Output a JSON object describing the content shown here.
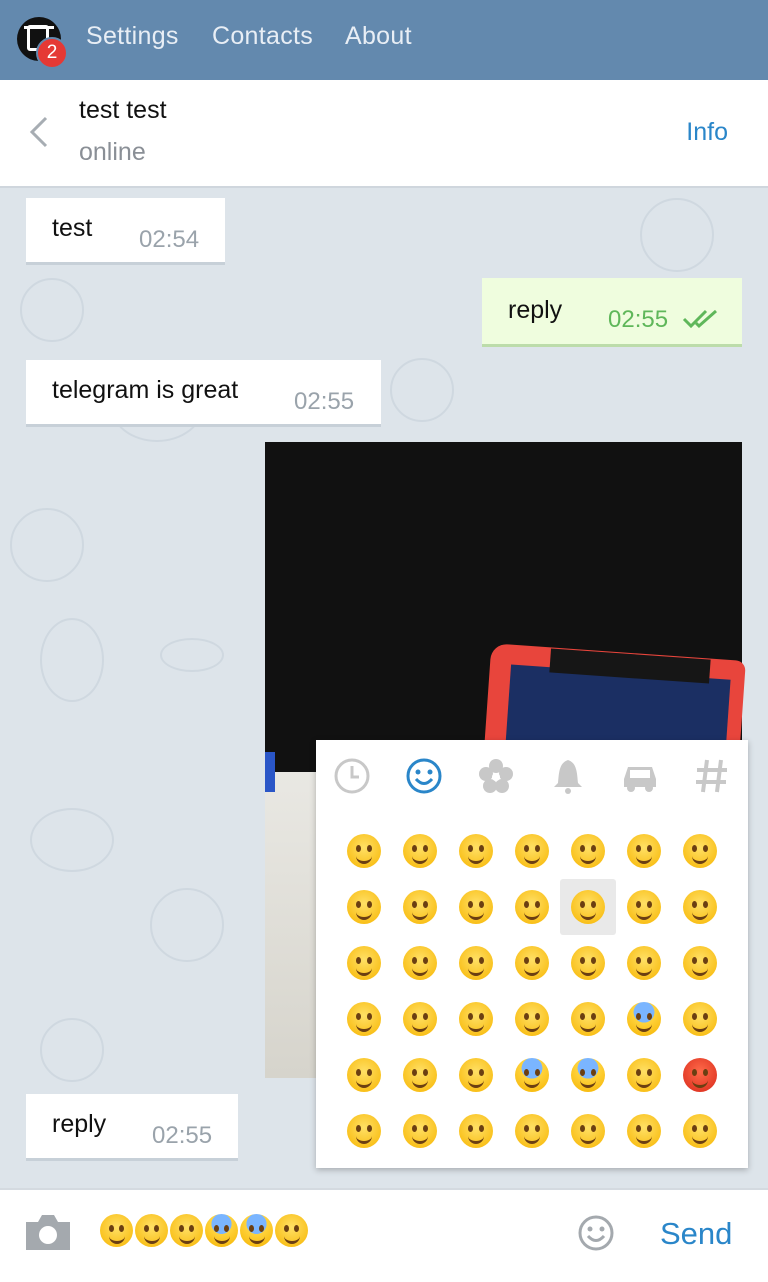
{
  "topbar": {
    "badge_count": "2",
    "nav": [
      "Settings",
      "Contacts",
      "About"
    ]
  },
  "chat_header": {
    "name": "test test",
    "status": "online",
    "info_label": "Info"
  },
  "messages": [
    {
      "text": "test",
      "time": "02:54",
      "direction": "in"
    },
    {
      "text": "reply",
      "time": "02:55",
      "direction": "out",
      "read": true
    },
    {
      "text": "telegram is great",
      "time": "02:55",
      "direction": "in"
    },
    {
      "type": "photo",
      "direction": "out"
    },
    {
      "text": "reply",
      "time": "02:55",
      "direction": "in"
    }
  ],
  "emoji_panel": {
    "categories": [
      "recent-clock-icon",
      "smiley-icon",
      "flower-icon",
      "bell-icon",
      "car-icon",
      "hash-icon"
    ],
    "active_category": "smiley-icon",
    "selected_emoji": "😜",
    "emojis": [
      [
        "😄",
        "😃",
        "😀",
        "😊",
        "☺️",
        "😉",
        "😍"
      ],
      [
        "😘",
        "😚",
        "😗",
        "😙",
        "😜",
        "😝",
        "😛"
      ],
      [
        "😳",
        "😁",
        "😔",
        "😌",
        "😒",
        "😞",
        "😣"
      ],
      [
        "😢",
        "😂",
        "😭",
        "😪",
        "😥",
        "😰",
        "😅"
      ],
      [
        "😓",
        "😩",
        "😫",
        "😨",
        "😱",
        "😠",
        "😡"
      ],
      [
        "😤",
        "😖",
        "😆",
        "😋",
        "😷",
        "😎",
        "😴"
      ]
    ]
  },
  "input": {
    "typed_emojis": [
      "😌",
      "😒",
      "😥",
      "😰",
      "😨",
      "😜"
    ],
    "send_label": "Send"
  },
  "colors": {
    "topbar": "#6389ae",
    "accent": "#2a86c9",
    "outgoing_bubble": "#effdde",
    "badge": "#e53935"
  }
}
